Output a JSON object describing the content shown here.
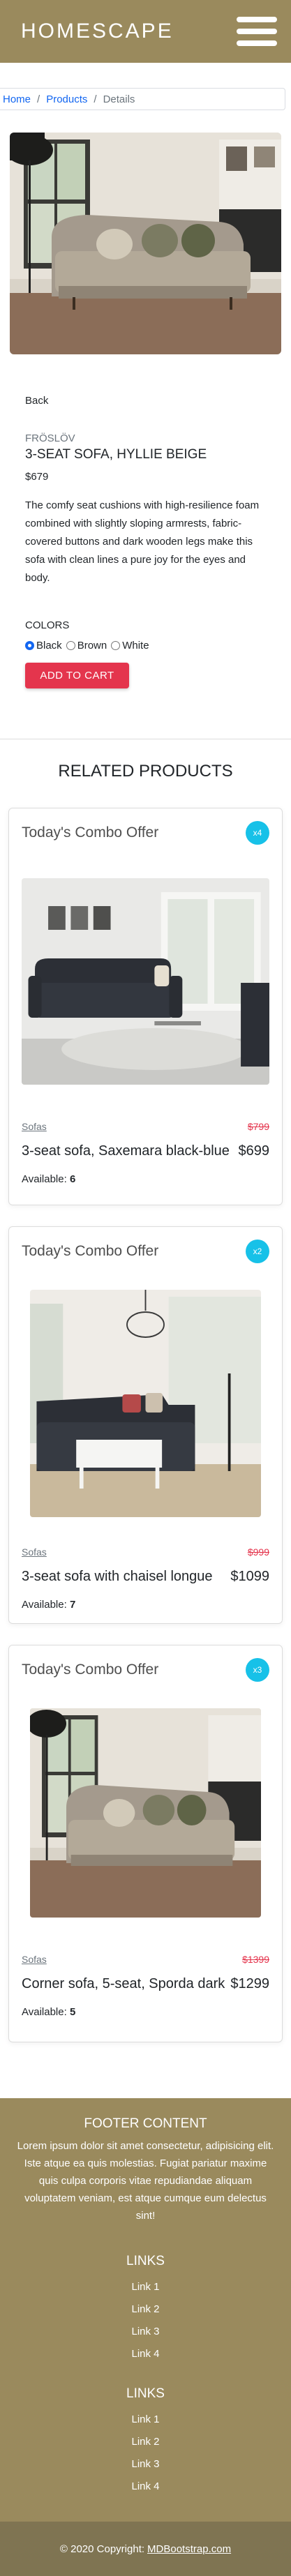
{
  "header": {
    "brand": "HOMESCAPE",
    "menu_icon": "hamburger-menu-icon"
  },
  "breadcrumb": {
    "home": "Home",
    "products": "Products",
    "current": "Details",
    "separator": "/"
  },
  "product": {
    "back": "Back",
    "brand": "FRÖSLÖV",
    "name": "3-SEAT SOFA, HYLLIE BEIGE",
    "price": "$679",
    "description": "The comfy seat cushions with high-resilience foam combined with slightly sloping armrests, fabric-covered buttons and dark wooden legs make this sofa with clean lines a pure joy for the eyes and body.",
    "colors_title": "COLORS",
    "colors": [
      {
        "label": "Black",
        "checked": true
      },
      {
        "label": "Brown",
        "checked": false
      },
      {
        "label": "White",
        "checked": false
      }
    ],
    "add_to_cart": "ADD TO CART"
  },
  "related": {
    "title": "RELATED PRODUCTS",
    "cards": [
      {
        "offer": "Today's Combo Offer",
        "badge": "x4",
        "category": "Sofas",
        "old_price": "$799",
        "name": "3-seat sofa, Saxemara black-blue",
        "price": "$699",
        "available_label": "Available:",
        "available": "6"
      },
      {
        "offer": "Today's Combo Offer",
        "badge": "x2",
        "category": "Sofas",
        "old_price": "$999",
        "name": "3-seat sofa with chaisel longue",
        "price": "$1099",
        "available_label": "Available:",
        "available": "7"
      },
      {
        "offer": "Today's Combo Offer",
        "badge": "x3",
        "category": "Sofas",
        "old_price": "$1399",
        "name": "Corner sofa, 5-seat, Sporda dark",
        "price": "$1299",
        "available_label": "Available:",
        "available": "5"
      }
    ]
  },
  "footer": {
    "content_title": "FOOTER CONTENT",
    "content_text": "Lorem ipsum dolor sit amet consectetur, adipisicing elit. Iste atque ea quis molestias. Fugiat pariatur maxime quis culpa corporis vitae repudiandae aliquam voluptatem veniam, est atque cumque eum delectus sint!",
    "links1": {
      "title": "LINKS",
      "items": [
        "Link 1",
        "Link 2",
        "Link 3",
        "Link 4"
      ]
    },
    "links2": {
      "title": "LINKS",
      "items": [
        "Link 1",
        "Link 2",
        "Link 3",
        "Link 4"
      ]
    },
    "copyright": "© 2020 Copyright:",
    "copyright_link": "MDBootstrap.com"
  },
  "colors": {
    "brand": "#9a8a5d",
    "footer_bottom": "#7f7452",
    "accent": "#e4354d",
    "link": "#1266f1",
    "badge": "#17c1e8"
  }
}
